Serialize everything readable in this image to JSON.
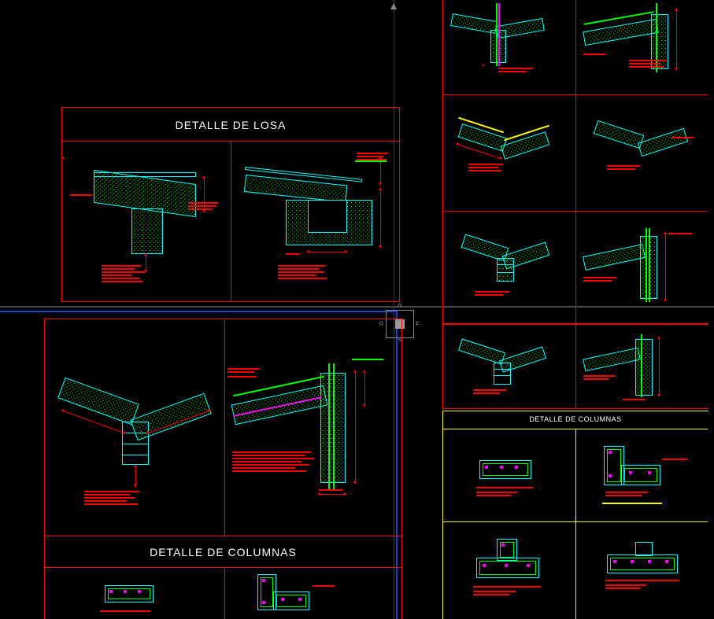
{
  "titles": {
    "losa": "DETALLE DE LOSA",
    "columnas_big": "DETALLE DE COLUMNAS",
    "columnas_small": "DETALLE DE COLUMNAS"
  },
  "compass": {
    "n": "N",
    "s": "S",
    "e": "E",
    "w": "O"
  }
}
